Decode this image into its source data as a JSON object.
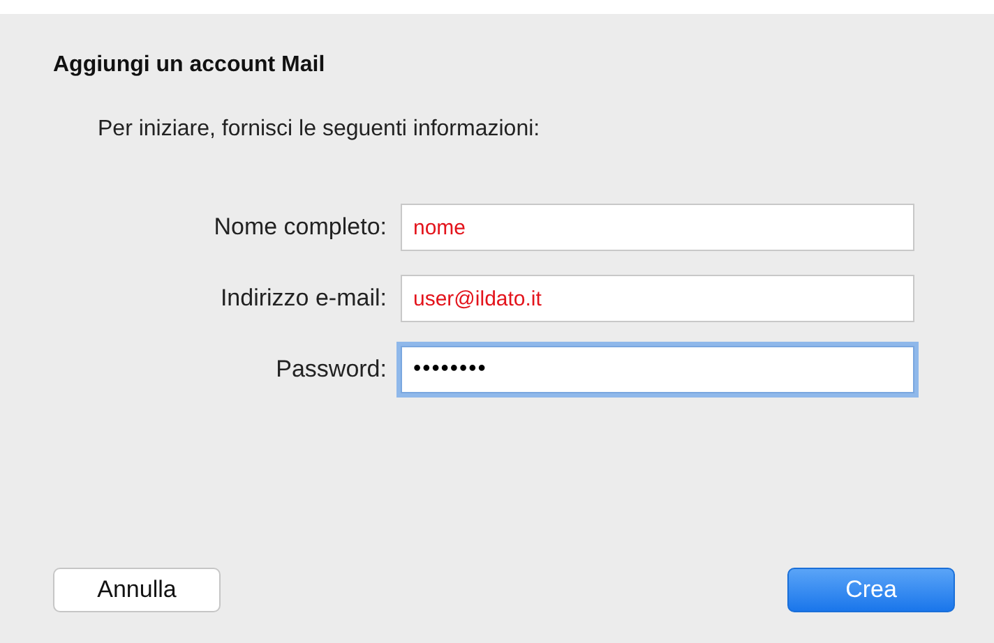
{
  "dialog": {
    "title": "Aggiungi un account Mail",
    "instructions": "Per iniziare, fornisci le seguenti informazioni:"
  },
  "fields": [
    {
      "label": "Nome completo:",
      "value": "nome",
      "kind": "text",
      "focused": false
    },
    {
      "label": "Indirizzo e-mail:",
      "value": "user@ildato.it",
      "kind": "text",
      "focused": false
    },
    {
      "label": "Password:",
      "value": "••••••••",
      "kind": "password",
      "focused": true
    }
  ],
  "buttons": [
    {
      "label": "Annulla",
      "kind": "default"
    },
    {
      "label": "Crea",
      "kind": "primary"
    }
  ]
}
